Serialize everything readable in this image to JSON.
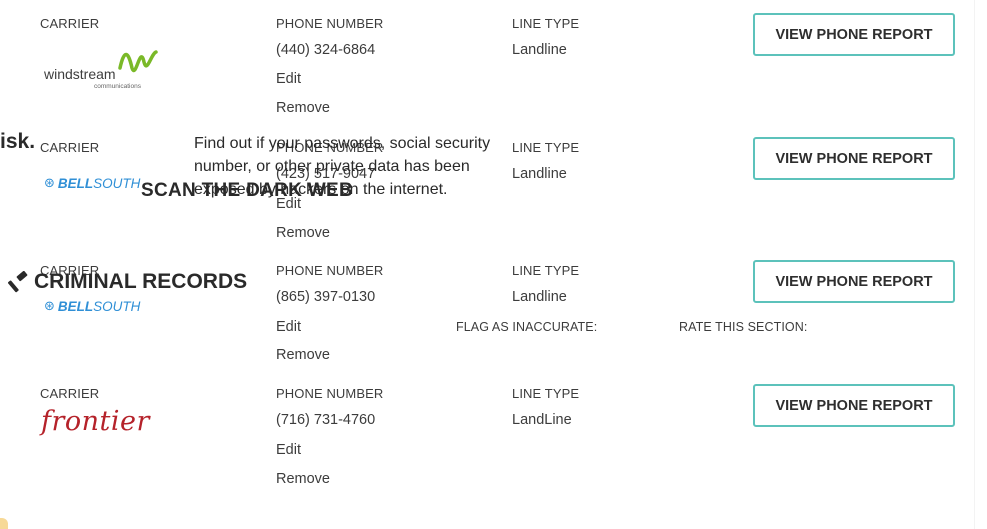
{
  "labels": {
    "carrier": "CARRIER",
    "phone_number": "PHONE NUMBER",
    "line_type": "LINE TYPE",
    "edit": "Edit",
    "remove": "Remove",
    "view_report": "VIEW PHONE REPORT"
  },
  "rows": [
    {
      "carrier_logo": "windstream",
      "logo_text": "windstream",
      "logo_sub": "communications",
      "phone": "(440) 324-6864",
      "line_type": "Landline"
    },
    {
      "carrier_logo": "bellsouth",
      "logo_text_bold": "BELL",
      "logo_text_light": "SOUTH",
      "phone": "(423) 517-9047",
      "line_type": "Landline"
    },
    {
      "carrier_logo": "bellsouth",
      "logo_text_bold": "BELL",
      "logo_text_light": "SOUTH",
      "phone": "(865) 397-0130",
      "line_type": "Landline"
    },
    {
      "carrier_logo": "frontier",
      "logo_text": "frontier",
      "phone": "(716) 731-4760",
      "line_type": "LandLine"
    }
  ],
  "feedback": {
    "flag": "FLAG AS INACCURATE:",
    "rate": "RATE THIS SECTION:"
  },
  "overlay": {
    "risk_fragment": "isk.",
    "dark_web_text": "Find out if your passwords, social security number, or other private data has been exposed by hackers on the internet.",
    "dark_web_title": "SCAN THE DARK WEB",
    "criminal_title": "CRIMINAL RECORDS",
    "criminal_icon": "gavel-icon"
  },
  "colors": {
    "button_border": "#5cc2bb",
    "bellsouth_blue": "#2f8fd6",
    "frontier_red": "#b5222a",
    "windstream_green": "#7ab928"
  }
}
